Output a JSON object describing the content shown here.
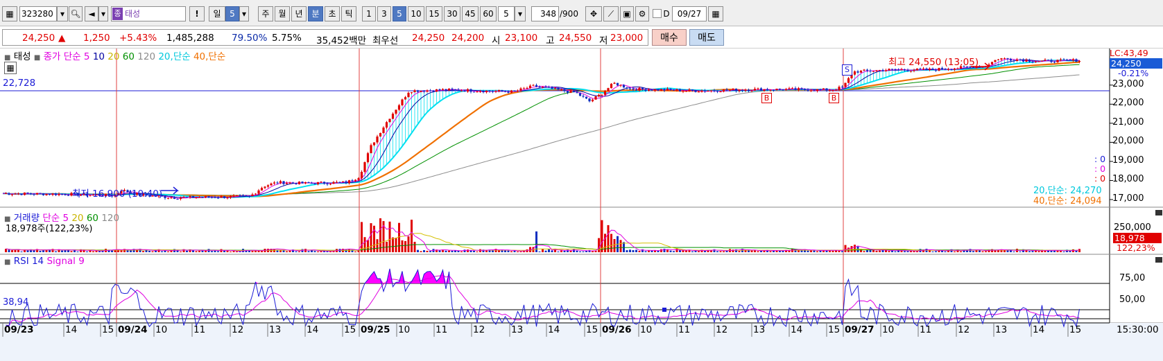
{
  "toolbar": {
    "code": "323280",
    "name_badge": "종",
    "name": "태성",
    "warn": "!",
    "periods": [
      "일",
      "5",
      "주",
      "월",
      "년",
      "분",
      "초",
      "틱"
    ],
    "minutes": [
      "1",
      "3",
      "5",
      "10",
      "15",
      "30",
      "45",
      "60"
    ],
    "interval": "5",
    "count": "348",
    "count_total": "/900",
    "d_label": "D",
    "date": "09/27"
  },
  "info": {
    "price": "24,250",
    "arrow": "▲",
    "change": "1,250",
    "change_pct": "+5.43%",
    "volume": "1,485,288",
    "vol_ratio": "79.50%",
    "turnover": "5.75%",
    "amount": "35,452백만",
    "best_label": "최우선",
    "ask": "24,250",
    "bid": "24,200",
    "open_label": "시",
    "open": "23,100",
    "high_label": "고",
    "high": "24,550",
    "low_label": "저",
    "low": "23,000",
    "buy": "매수",
    "sell": "매도"
  },
  "price_panel": {
    "legend": {
      "title": "태성",
      "ma_label": "종가 단순",
      "ma5": "5",
      "ma10": "10",
      "ma20": "20",
      "ma60": "60",
      "ma120": "120",
      "ma20s": "20,단순",
      "ma40s": "40,단순"
    },
    "ref_value": "22,728",
    "max_label": "최고 24,550 (13:05)",
    "min_label": "최저 16,900 (10:40)",
    "lc_label": "LC:43,49",
    "current_tag": "24,250",
    "current_pct": "-0.21%",
    "side_zero": [
      ": 0",
      ": 0",
      ": 0"
    ],
    "ma20_val": "20,단순: 24,270",
    "ma40_val": "40,단순: 24,094",
    "markers": {
      "s": "S",
      "b": "B"
    },
    "axis": [
      "23,000",
      "22,000",
      "21,000",
      "20,000",
      "19,000",
      "18,000",
      "17,000"
    ]
  },
  "volume_panel": {
    "legend": {
      "title": "거래량",
      "label": "단순",
      "ma5": "5",
      "ma20": "20",
      "ma60": "60",
      "ma120": "120"
    },
    "value": "18,978주(122,23%)",
    "axis": "250,000",
    "tag": "18,978",
    "tag_pct": "122,23%"
  },
  "rsi_panel": {
    "legend": {
      "title": "RSI 14",
      "signal": "Signal 9"
    },
    "value": "38,94",
    "axis": [
      "75,00",
      "50,00"
    ]
  },
  "time_axis": {
    "labels": [
      "09/23",
      "14",
      "15",
      "09/24",
      "10",
      "11",
      "12",
      "13",
      "14",
      "15",
      "09/25",
      "10",
      "11",
      "12",
      "13",
      "14",
      "15",
      "09/26",
      "10",
      "11",
      "12",
      "13",
      "14",
      "15",
      "09/27",
      "10",
      "11",
      "12",
      "13",
      "14",
      "15"
    ],
    "end_time": "15:30:00"
  },
  "chart_data": {
    "type": "line",
    "x": [
      "09/23",
      "09/24",
      "09/25",
      "09/26",
      "09/27"
    ],
    "series": [
      {
        "name": "종가",
        "values": [
          17300,
          17100,
          22728,
          22800,
          24250
        ]
      }
    ],
    "ylim": [
      16600,
      24700
    ]
  },
  "colors": {
    "up": "#e00000",
    "down": "#1030c0",
    "ma5": "#e000e0",
    "ma10": "#0000a0",
    "ma20": "#d4c000",
    "ma60": "#009000",
    "ma120": "#8c8c8c",
    "ma20s": "#00e0f0",
    "ma40s": "#f07000"
  }
}
